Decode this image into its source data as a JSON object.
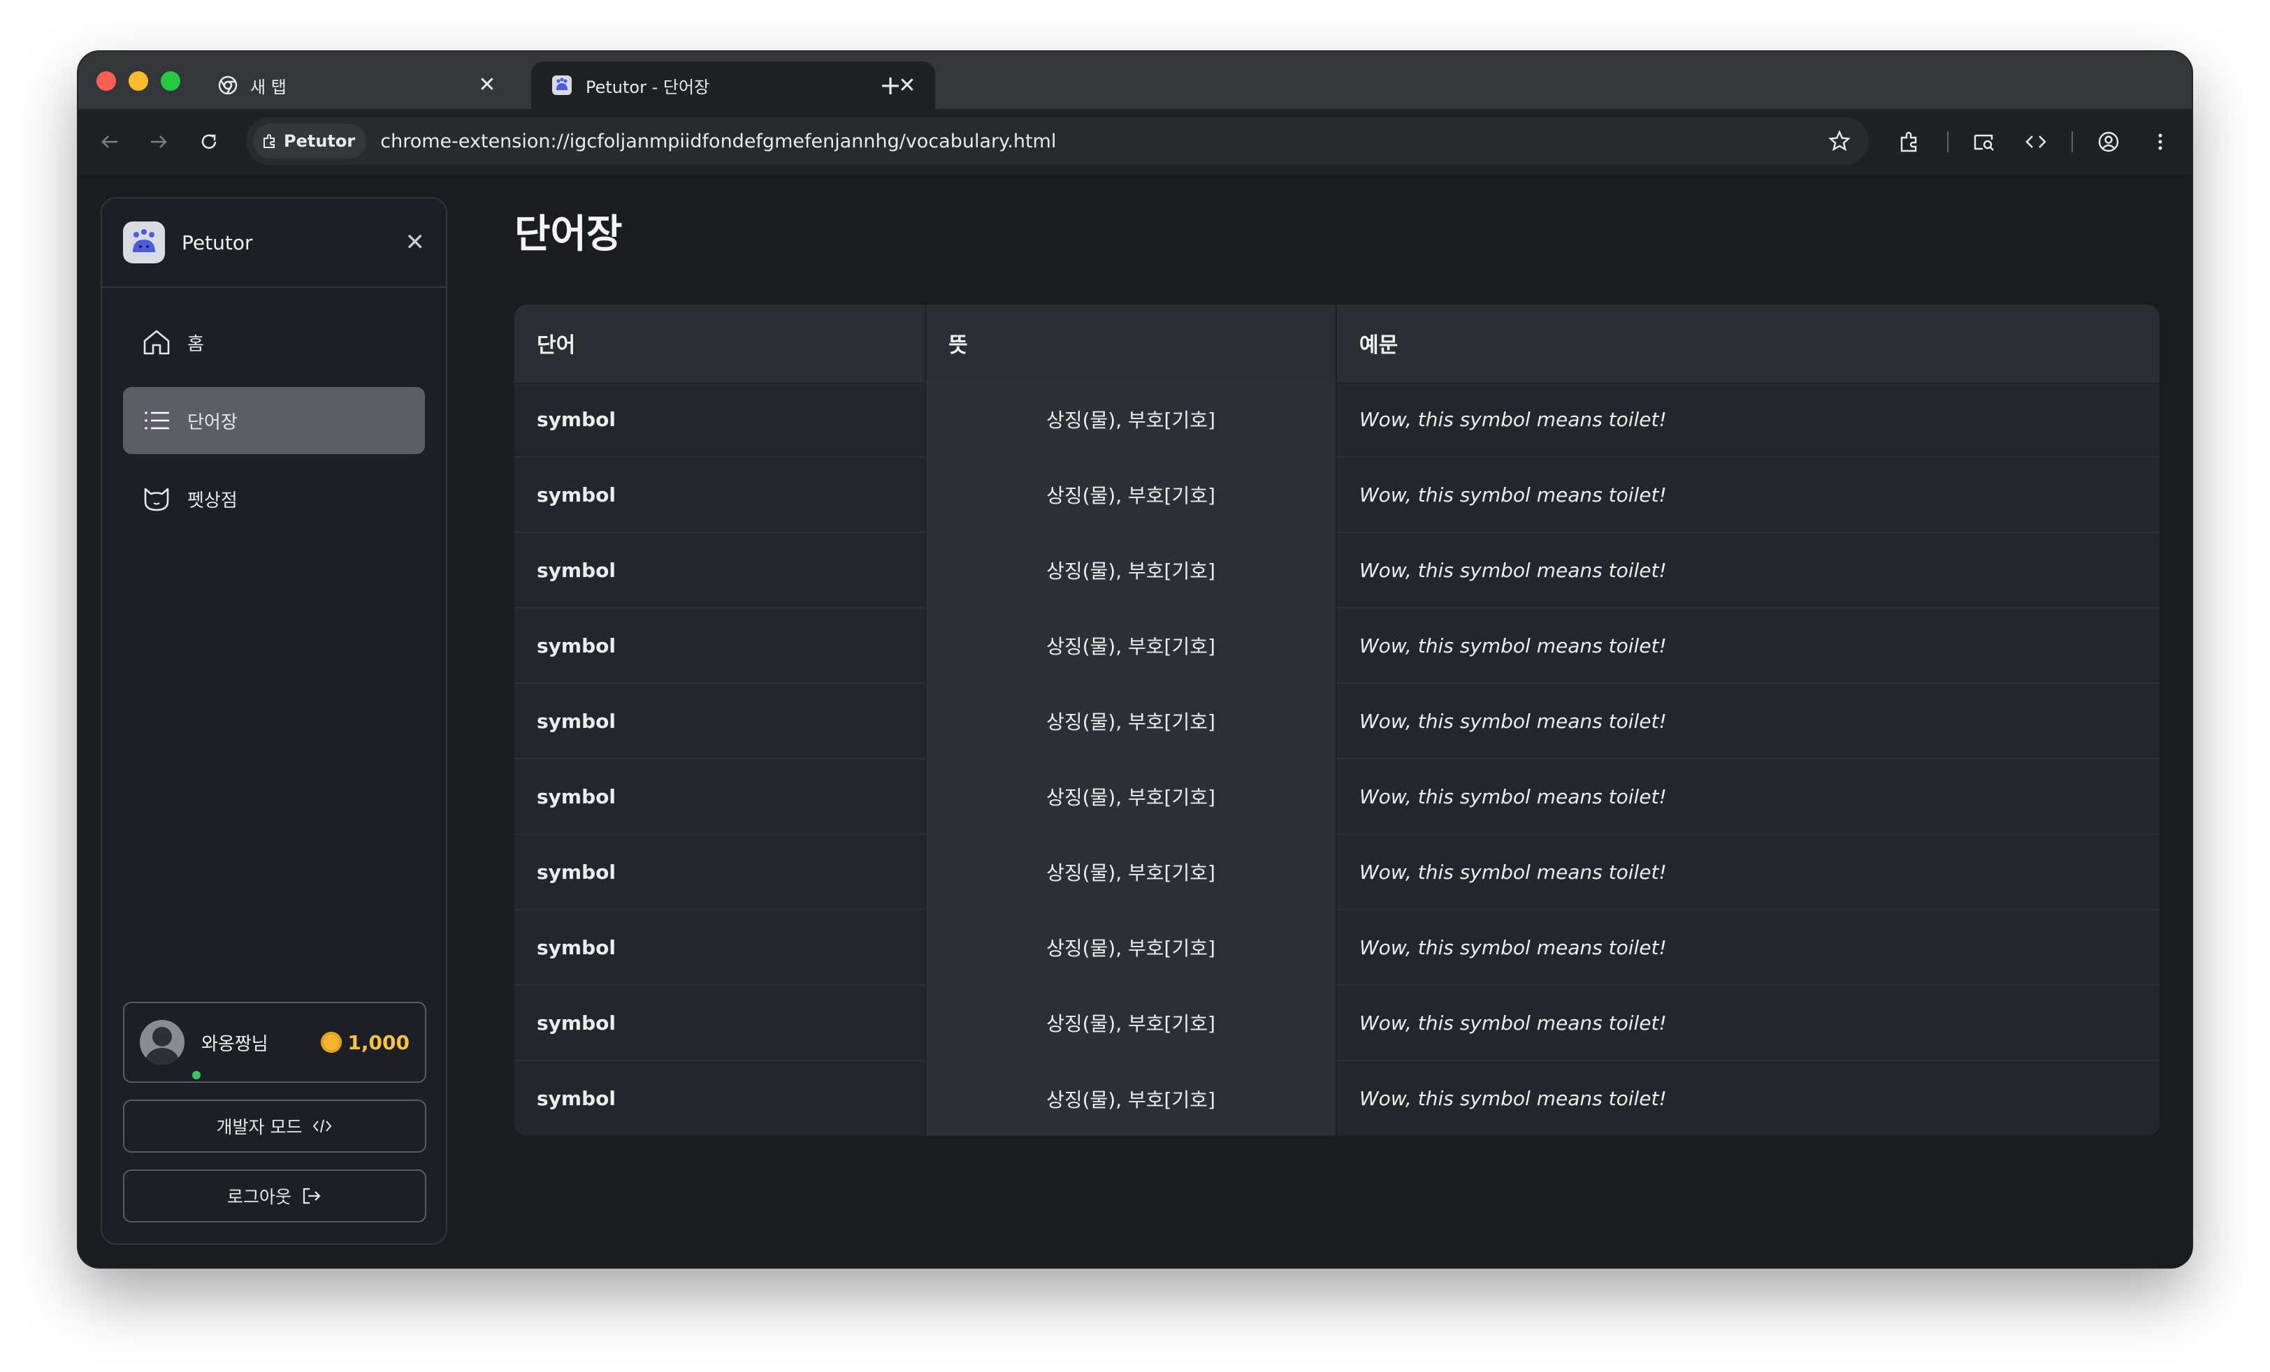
{
  "browser": {
    "tabs": [
      {
        "title": "새 탭",
        "active": false
      },
      {
        "title": "Petutor - 단어장",
        "active": true
      }
    ],
    "extension_chip": "Petutor",
    "url": "chrome-extension://igcfoljanmpiidfondefgmefenjannhg/vocabulary.html"
  },
  "sidebar": {
    "title": "Petutor",
    "items": [
      {
        "label": "홈",
        "icon": "home-icon",
        "active": false
      },
      {
        "label": "단어장",
        "icon": "list-icon",
        "active": true
      },
      {
        "label": "펫상점",
        "icon": "cat-icon",
        "active": false
      }
    ],
    "profile": {
      "name": "와옹짱님",
      "points": "1,000"
    },
    "dev_mode_label": "개발자 모드",
    "logout_label": "로그아웃"
  },
  "main": {
    "title": "단어장",
    "table": {
      "headers": [
        "단어",
        "뜻",
        "예문"
      ],
      "rows": [
        {
          "word": "symbol",
          "meaning": "상징(물), 부호[기호]",
          "example": "Wow, this symbol means toilet!"
        },
        {
          "word": "symbol",
          "meaning": "상징(물), 부호[기호]",
          "example": "Wow, this symbol means toilet!"
        },
        {
          "word": "symbol",
          "meaning": "상징(물), 부호[기호]",
          "example": "Wow, this symbol means toilet!"
        },
        {
          "word": "symbol",
          "meaning": "상징(물), 부호[기호]",
          "example": "Wow, this symbol means toilet!"
        },
        {
          "word": "symbol",
          "meaning": "상징(물), 부호[기호]",
          "example": "Wow, this symbol means toilet!"
        },
        {
          "word": "symbol",
          "meaning": "상징(물), 부호[기호]",
          "example": "Wow, this symbol means toilet!"
        },
        {
          "word": "symbol",
          "meaning": "상징(물), 부호[기호]",
          "example": "Wow, this symbol means toilet!"
        },
        {
          "word": "symbol",
          "meaning": "상징(물), 부호[기호]",
          "example": "Wow, this symbol means toilet!"
        },
        {
          "word": "symbol",
          "meaning": "상징(물), 부호[기호]",
          "example": "Wow, this symbol means toilet!"
        },
        {
          "word": "symbol",
          "meaning": "상징(물), 부호[기호]",
          "example": "Wow, this symbol means toilet!"
        }
      ]
    }
  },
  "colors": {
    "background": "#1b1c20",
    "active_nav": "#5c5e65",
    "coin": "#f2b632",
    "online": "#3ec46d"
  }
}
